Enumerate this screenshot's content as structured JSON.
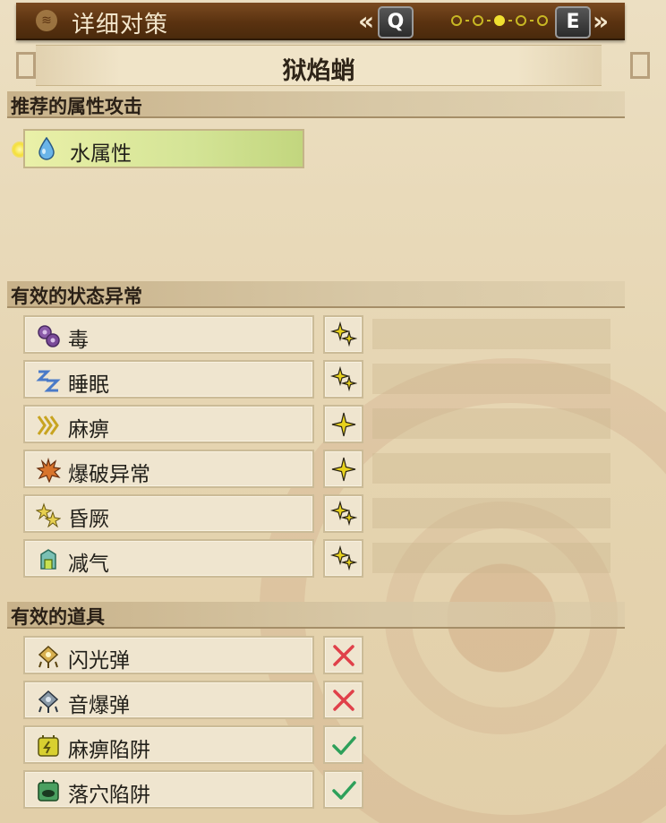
{
  "header": {
    "title": "详细对策",
    "title_icon": "layers-icon",
    "prev_key": "Q",
    "next_key": "E",
    "prev_arrow": "«",
    "next_arrow": "»",
    "page_count": 5,
    "current_page": 3
  },
  "monster": {
    "name": "狱焰蛸"
  },
  "sections": {
    "element": {
      "label": "推荐的属性攻击"
    },
    "status": {
      "label": "有效的状态异常"
    },
    "items": {
      "label": "有效的道具"
    }
  },
  "element": {
    "label": "水属性",
    "icon": "water-drop-icon"
  },
  "status_rows": [
    {
      "label": "毒",
      "icon": "poison-icon",
      "rating": 2
    },
    {
      "label": "睡眠",
      "icon": "sleep-icon",
      "rating": 2
    },
    {
      "label": "麻痹",
      "icon": "paralysis-icon",
      "rating": 1
    },
    {
      "label": "爆破异常",
      "icon": "blast-icon",
      "rating": 1
    },
    {
      "label": "昏厥",
      "icon": "stun-icon",
      "rating": 2
    },
    {
      "label": "减气",
      "icon": "exhaust-icon",
      "rating": 2
    }
  ],
  "item_rows": [
    {
      "label": "闪光弹",
      "icon": "flash-pod-icon",
      "effective": false
    },
    {
      "label": "音爆弹",
      "icon": "sonic-bomb-icon",
      "effective": false
    },
    {
      "label": "麻痹陷阱",
      "icon": "shock-trap-icon",
      "effective": true
    },
    {
      "label": "落穴陷阱",
      "icon": "pitfall-trap-icon",
      "effective": true
    }
  ],
  "colors": {
    "star": "#e8d21c",
    "cross": "#e0404a",
    "check": "#2ea05a"
  }
}
